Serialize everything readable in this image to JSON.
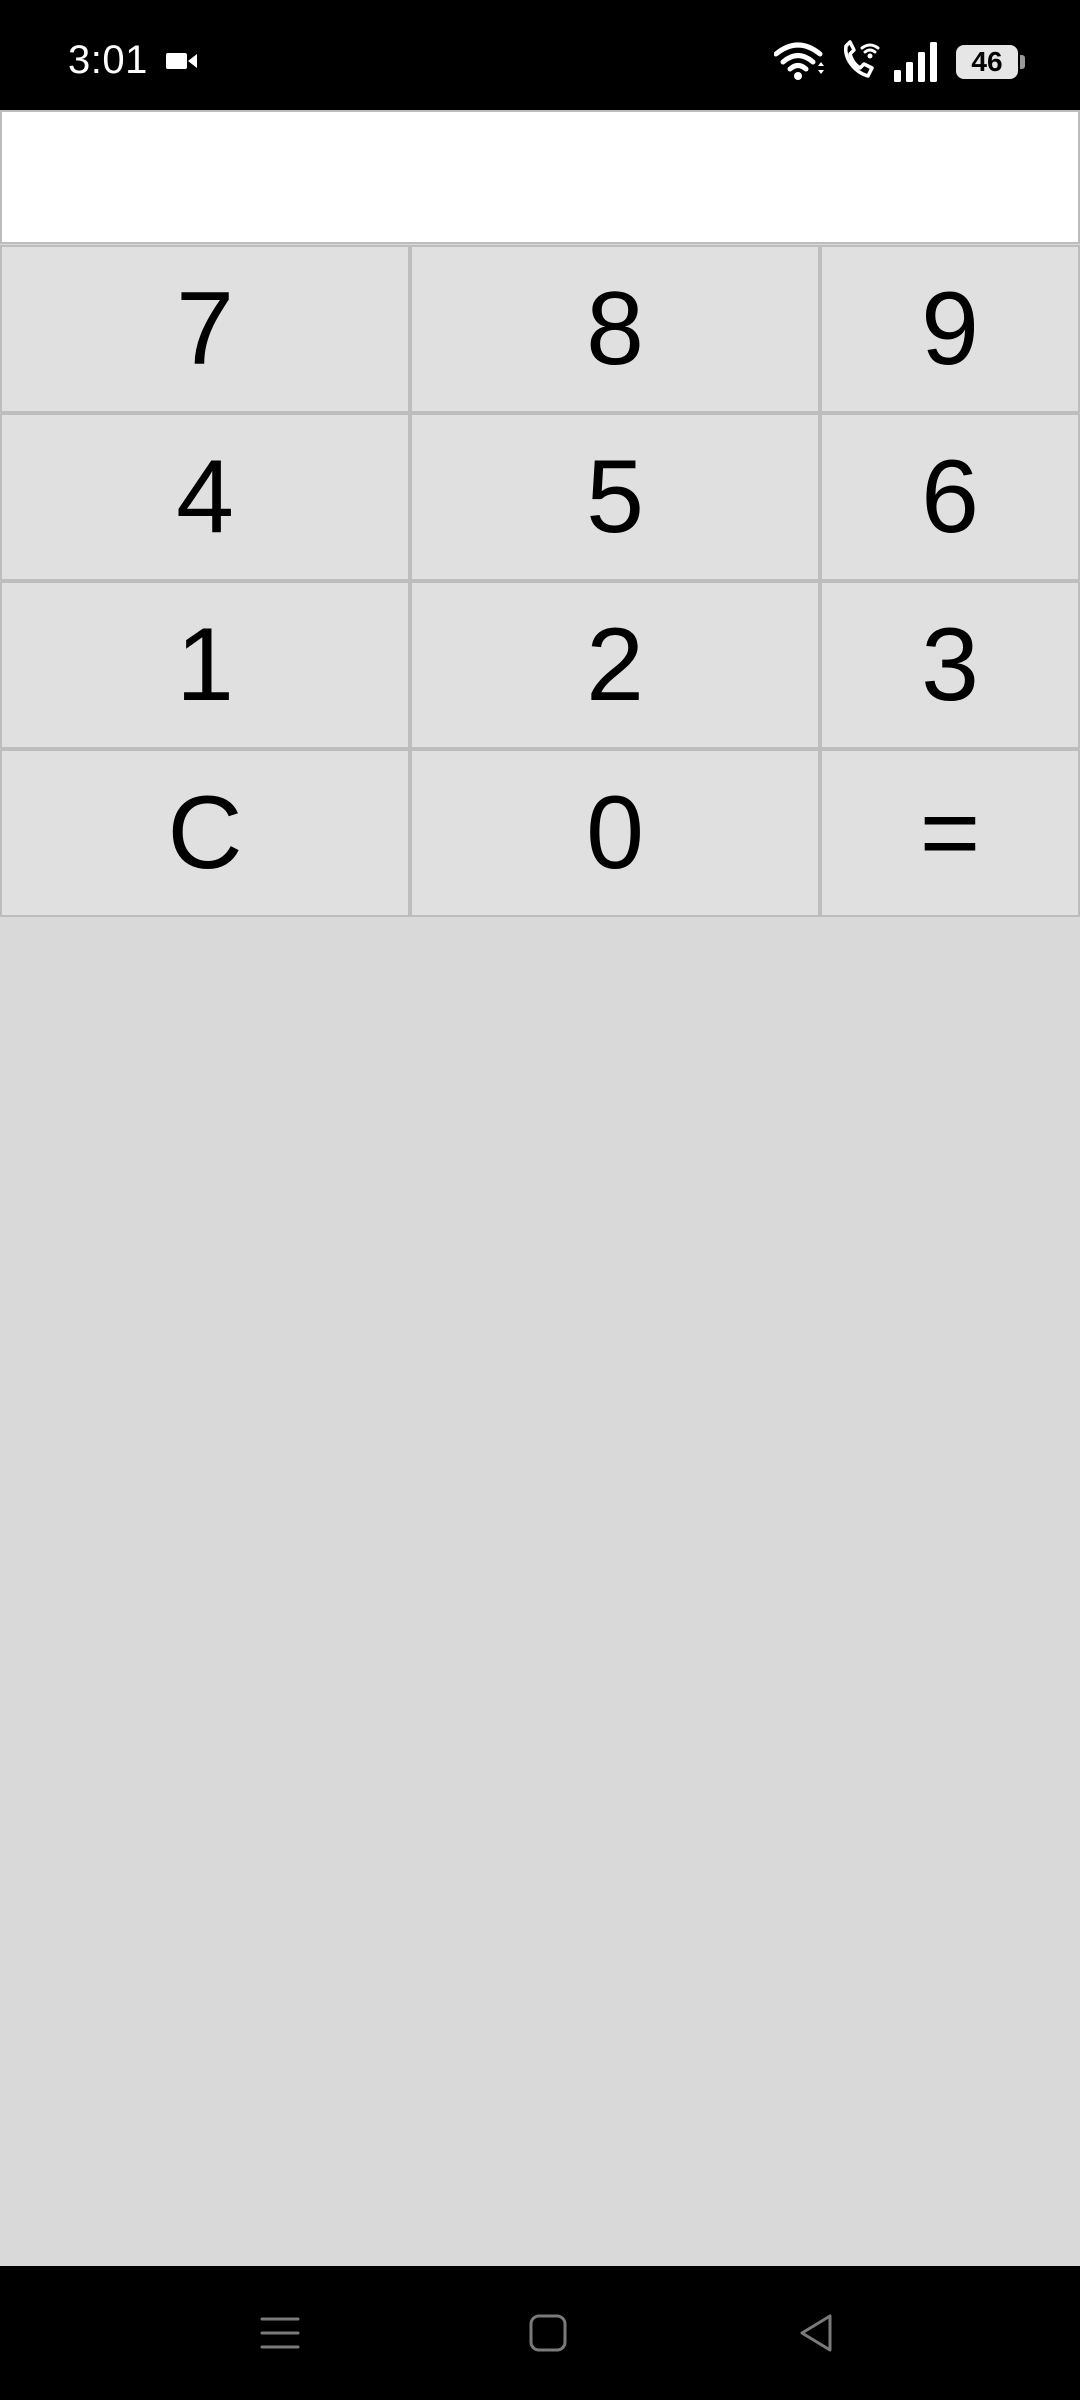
{
  "status_bar": {
    "time": "3:01",
    "battery_level": "46",
    "icons": [
      "video-camera-icon",
      "wifi-icon",
      "wifi-calling-icon",
      "signal-icon",
      "battery-icon"
    ]
  },
  "display": {
    "value": ""
  },
  "keypad": {
    "rows": [
      [
        "7",
        "8",
        "9"
      ],
      [
        "4",
        "5",
        "6"
      ],
      [
        "1",
        "2",
        "3"
      ],
      [
        "C",
        "0",
        "="
      ]
    ]
  },
  "nav_bar": {
    "buttons": [
      "menu-icon",
      "home-icon",
      "back-icon"
    ]
  },
  "colors": {
    "background": "#d9d9d9",
    "key_background": "#e0e0e0",
    "key_border": "#bdbdbd",
    "display_background": "#ffffff",
    "system_bars": "#000000"
  }
}
